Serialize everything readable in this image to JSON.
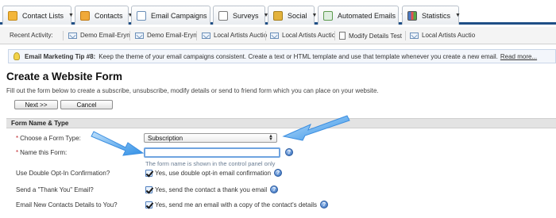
{
  "nav": {
    "tabs": [
      {
        "label": "Contact Lists",
        "icon": "contact-lists-icon"
      },
      {
        "label": "Contacts",
        "icon": "contacts-icon"
      },
      {
        "label": "Email Campaigns",
        "icon": "email-campaigns-icon"
      },
      {
        "label": "Surveys",
        "icon": "surveys-icon"
      },
      {
        "label": "Social",
        "icon": "social-icon"
      },
      {
        "label": "Automated Emails",
        "icon": "automated-emails-icon"
      },
      {
        "label": "Statistics",
        "icon": "statistics-icon"
      }
    ],
    "accent_color": "#1f4f86"
  },
  "recent_activity": {
    "label": "Recent Activity:",
    "items": [
      {
        "label": "Demo Email-Eryn",
        "icon": "email-icon"
      },
      {
        "label": "Demo Email-Eryn",
        "icon": "email-icon"
      },
      {
        "label": "Local Artists Auctio",
        "icon": "email-icon"
      },
      {
        "label": "Local Artists Auctio",
        "icon": "email-icon"
      },
      {
        "label": "Modify Details Test",
        "icon": "document-icon"
      },
      {
        "label": "Local Artists Auctio",
        "icon": "email-icon"
      }
    ]
  },
  "tip": {
    "title": "Email Marketing Tip #8:",
    "text": "Keep the theme of your email campaigns consistent. Create a text or HTML template and use that template whenever you create a new email.",
    "link": "Read more..."
  },
  "page": {
    "title": "Create a Website Form",
    "intro": "Fill out the form below to create a subscribe, unsubscribe, modify details or send to friend form which you can place on your website.",
    "next_button": "Next >>",
    "cancel_button": "Cancel"
  },
  "form": {
    "section_title": "Form Name & Type",
    "form_type": {
      "label": "Choose a Form Type:",
      "required": "*",
      "value": "Subscription"
    },
    "form_name": {
      "label": "Name this Form:",
      "required": "*",
      "value": "",
      "hint": "The form name is shown in the control panel only"
    },
    "double_optin": {
      "label": "Use Double Opt-In Confirmation?",
      "option": "Yes, use double opt-in email confirmation",
      "checked": true
    },
    "thank_you": {
      "label": "Send a \"Thank You\" Email?",
      "option": "Yes, send the contact a thank you email",
      "checked": true
    },
    "notify": {
      "label": "Email New Contacts Details to You?",
      "option": "Yes, send me an email with a copy of the contact's details",
      "checked": true
    }
  }
}
